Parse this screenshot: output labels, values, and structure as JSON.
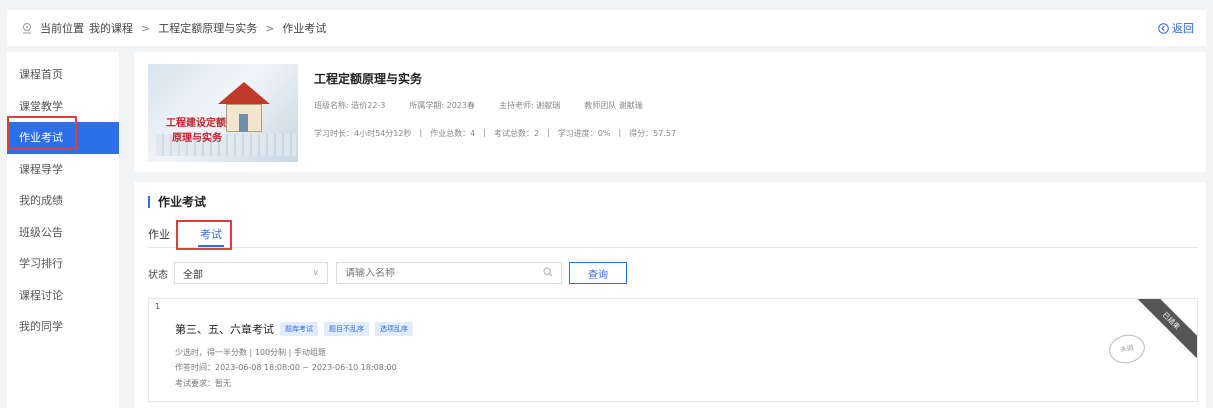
{
  "breadcrumb": {
    "prefix": "当前位置",
    "items": [
      "我的课程",
      "工程定额原理与实务",
      "作业考试"
    ],
    "separator": ">",
    "back_label": "返回"
  },
  "sidebar": {
    "items": [
      {
        "label": "课程首页"
      },
      {
        "label": "课堂教学"
      },
      {
        "label": "作业考试"
      },
      {
        "label": "课程导学"
      },
      {
        "label": "我的成绩"
      },
      {
        "label": "班级公告"
      },
      {
        "label": "学习排行"
      },
      {
        "label": "课程讨论"
      },
      {
        "label": "我的同学"
      }
    ],
    "active_index": 2
  },
  "course": {
    "cover_text_line1": "工程建设定额",
    "cover_text_line2": "原理与实务",
    "title": "工程定额原理与实务",
    "class_name": "班级名称: 造价22-3",
    "semester": "所属学期: 2023春",
    "teacher": "主持老师: 谢献瑞",
    "team": "教师团队 谢献瑞",
    "stats": {
      "study_time": "学习时长：4小时54分12秒",
      "homework_total": "作业总数：4",
      "exam_total": "考试总数：2",
      "progress": "学习进度：0%",
      "score": "得分：57.57",
      "separator": "|"
    }
  },
  "panel": {
    "title": "作业考试",
    "tabs": [
      {
        "label": "作业"
      },
      {
        "label": "考试"
      }
    ],
    "active_tab": 1,
    "filter": {
      "status_label": "状态",
      "status_value": "全部",
      "search_placeholder": "请输入名称",
      "query_label": "查询"
    }
  },
  "exams": [
    {
      "index": "1",
      "title": "第三、五、六章考试",
      "tags": [
        "题库考试",
        "题目不乱序",
        "选项乱序"
      ],
      "rules": "少选时，得一半分数 | 100分制 | 手动组题",
      "time": "作答时间：2023-06-08 18:08:00 ~ 2023-06-10 18:08:00",
      "requirement": "考试要求：暂无",
      "ribbon": "已结束",
      "stamp": "未做"
    }
  ],
  "colors": {
    "accent": "#2c6fe8",
    "highlight_box": "#e23c3c"
  }
}
